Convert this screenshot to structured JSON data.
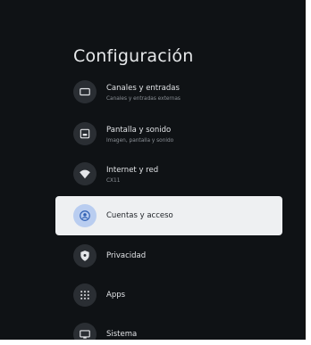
{
  "page": {
    "title": "Configuración"
  },
  "menu": {
    "items": [
      {
        "label": "Canales y entradas",
        "sub": "Canales y entradas externas",
        "icon": "tv-icon"
      },
      {
        "label": "Pantalla y sonido",
        "sub": "Imagen, pantalla y sonido",
        "icon": "display-icon"
      },
      {
        "label": "Internet y red",
        "sub": "CX11",
        "icon": "wifi-icon"
      },
      {
        "label": "Cuentas y acceso",
        "sub": "",
        "icon": "account-icon",
        "selected": true
      },
      {
        "label": "Privacidad",
        "sub": "",
        "icon": "shield-icon"
      },
      {
        "label": "Apps",
        "sub": "",
        "icon": "apps-grid-icon"
      },
      {
        "label": "Sistema",
        "sub": "",
        "icon": "monitor-icon"
      }
    ]
  },
  "colors": {
    "background": "#0f1215",
    "selected_bg": "#eef0f2",
    "selected_icon_bg": "#b9cdf0",
    "icon_bg": "#2a2e33"
  }
}
